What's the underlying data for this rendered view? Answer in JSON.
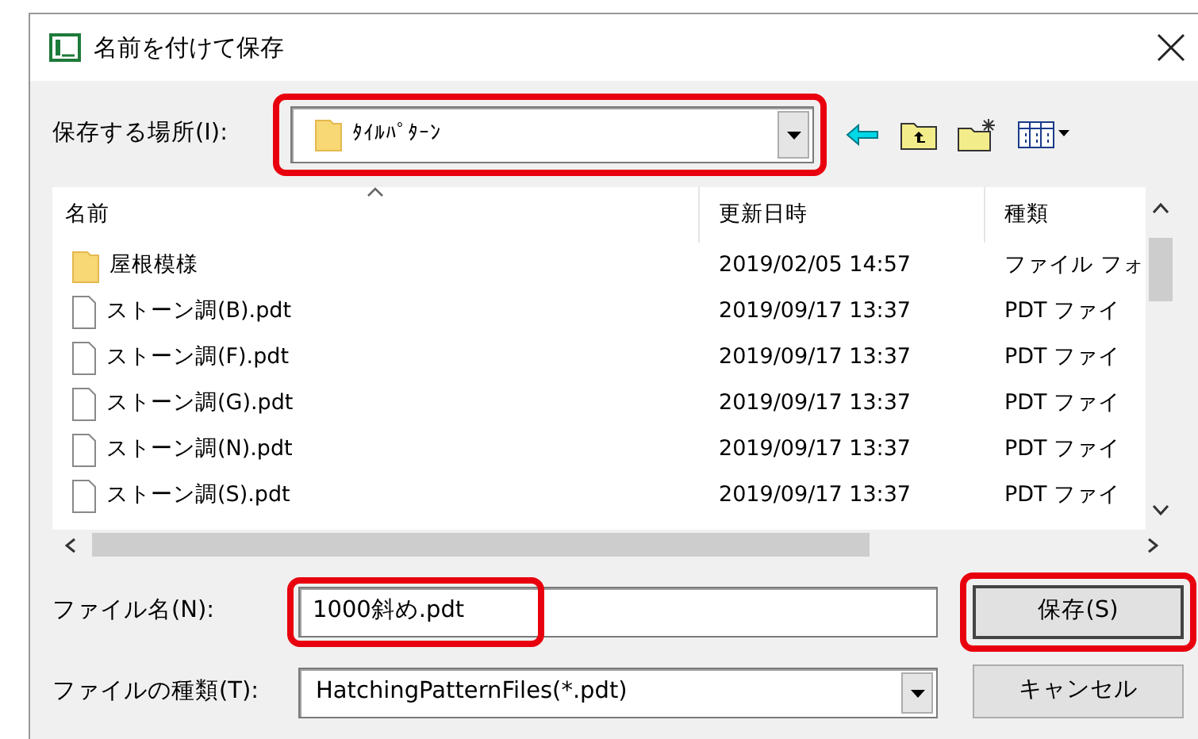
{
  "window": {
    "title": "名前を付けて保存"
  },
  "location": {
    "label": "保存する場所(I):",
    "value": "ﾀｲﾙﾊﾟﾀｰﾝ",
    "highlighted": true
  },
  "columns": [
    {
      "label": "名前",
      "sorted": true
    },
    {
      "label": "更新日時",
      "sorted": false
    },
    {
      "label": "種類",
      "sorted": false
    }
  ],
  "rows": [
    {
      "kind": "folder",
      "name": "屋根模様",
      "modified": "2019/02/05 14:57",
      "type": "ファイル フォ"
    },
    {
      "kind": "file",
      "name": "ストーン調(B).pdt",
      "modified": "2019/09/17 13:37",
      "type": "PDT ファイ"
    },
    {
      "kind": "file",
      "name": "ストーン調(F).pdt",
      "modified": "2019/09/17 13:37",
      "type": "PDT ファイ"
    },
    {
      "kind": "file",
      "name": "ストーン調(G).pdt",
      "modified": "2019/09/17 13:37",
      "type": "PDT ファイ"
    },
    {
      "kind": "file",
      "name": "ストーン調(N).pdt",
      "modified": "2019/09/17 13:37",
      "type": "PDT ファイ"
    },
    {
      "kind": "file",
      "name": "ストーン調(S).pdt",
      "modified": "2019/09/17 13:37",
      "type": "PDT ファイ"
    }
  ],
  "file_name": {
    "label": "ファイル名(N):",
    "value": "1000斜め.pdt",
    "highlighted": true
  },
  "file_type": {
    "label": "ファイルの種類(T):",
    "value": "HatchingPatternFiles(*.pdt)"
  },
  "buttons": [
    {
      "label": "保存(S)",
      "default": true,
      "highlighted": true
    },
    {
      "label": "キャンセル",
      "default": false,
      "highlighted": false
    }
  ]
}
